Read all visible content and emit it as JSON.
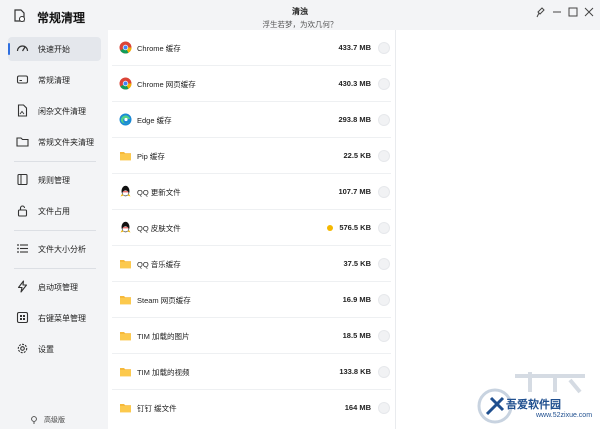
{
  "titlebar": {
    "app_title": "常规清理",
    "title": "清浊",
    "subtitle": "浮生若梦，为欢几何？",
    "icons": [
      "app-logo-icon",
      "pin-icon",
      "minimize-icon",
      "maximize-icon",
      "close-icon"
    ]
  },
  "sidebar": {
    "items": [
      {
        "label": "快速开始",
        "icon": "gauge-icon",
        "active": true
      },
      {
        "label": "常规清理",
        "icon": "drive-icon"
      },
      {
        "label": "闲杂文件清理",
        "icon": "file-image-icon"
      },
      {
        "label": "常规文件夹清理",
        "icon": "folder-icon"
      },
      {
        "label": "规则管理",
        "icon": "book-icon"
      },
      {
        "label": "文件占用",
        "icon": "lock-icon"
      },
      {
        "label": "文件大小分析",
        "icon": "list-icon"
      },
      {
        "label": "启动项管理",
        "icon": "bolt-icon"
      },
      {
        "label": "右键菜单管理",
        "icon": "menu-grid-icon"
      },
      {
        "label": "设置",
        "icon": "gear-icon"
      }
    ],
    "version": "高级版",
    "accent": "#2f6fe0"
  },
  "items": [
    {
      "name": "Chrome 缓存",
      "size": "433.7 MB",
      "icon": "chrome-icon"
    },
    {
      "name": "Chrome 网页缓存",
      "size": "430.3 MB",
      "icon": "chrome-icon"
    },
    {
      "name": "Edge 缓存",
      "size": "293.8 MB",
      "icon": "edge-icon"
    },
    {
      "name": "Pip 缓存",
      "size": "22.5 KB",
      "icon": "folder-icon"
    },
    {
      "name": "QQ 更新文件",
      "size": "107.7 MB",
      "icon": "qq-icon"
    },
    {
      "name": "QQ 皮肤文件",
      "size": "576.5 KB",
      "icon": "qq-icon",
      "indicator": true
    },
    {
      "name": "QQ 音乐缓存",
      "size": "37.5 KB",
      "icon": "folder-icon"
    },
    {
      "name": "Steam 网页缓存",
      "size": "16.9 MB",
      "icon": "folder-icon"
    },
    {
      "name": "TIM 加载的图片",
      "size": "18.5 MB",
      "icon": "folder-icon"
    },
    {
      "name": "TIM 加载的视频",
      "size": "133.8 KB",
      "icon": "folder-icon"
    },
    {
      "name": "钉钉 缓文件",
      "size": "164 MB",
      "icon": "dingtalk-icon"
    }
  ],
  "watermark": {
    "text": "吾爱软件园",
    "url": "www.52zixue.com"
  },
  "colors": {
    "folder": "#f6b93b",
    "indicator": "#f5b800"
  }
}
